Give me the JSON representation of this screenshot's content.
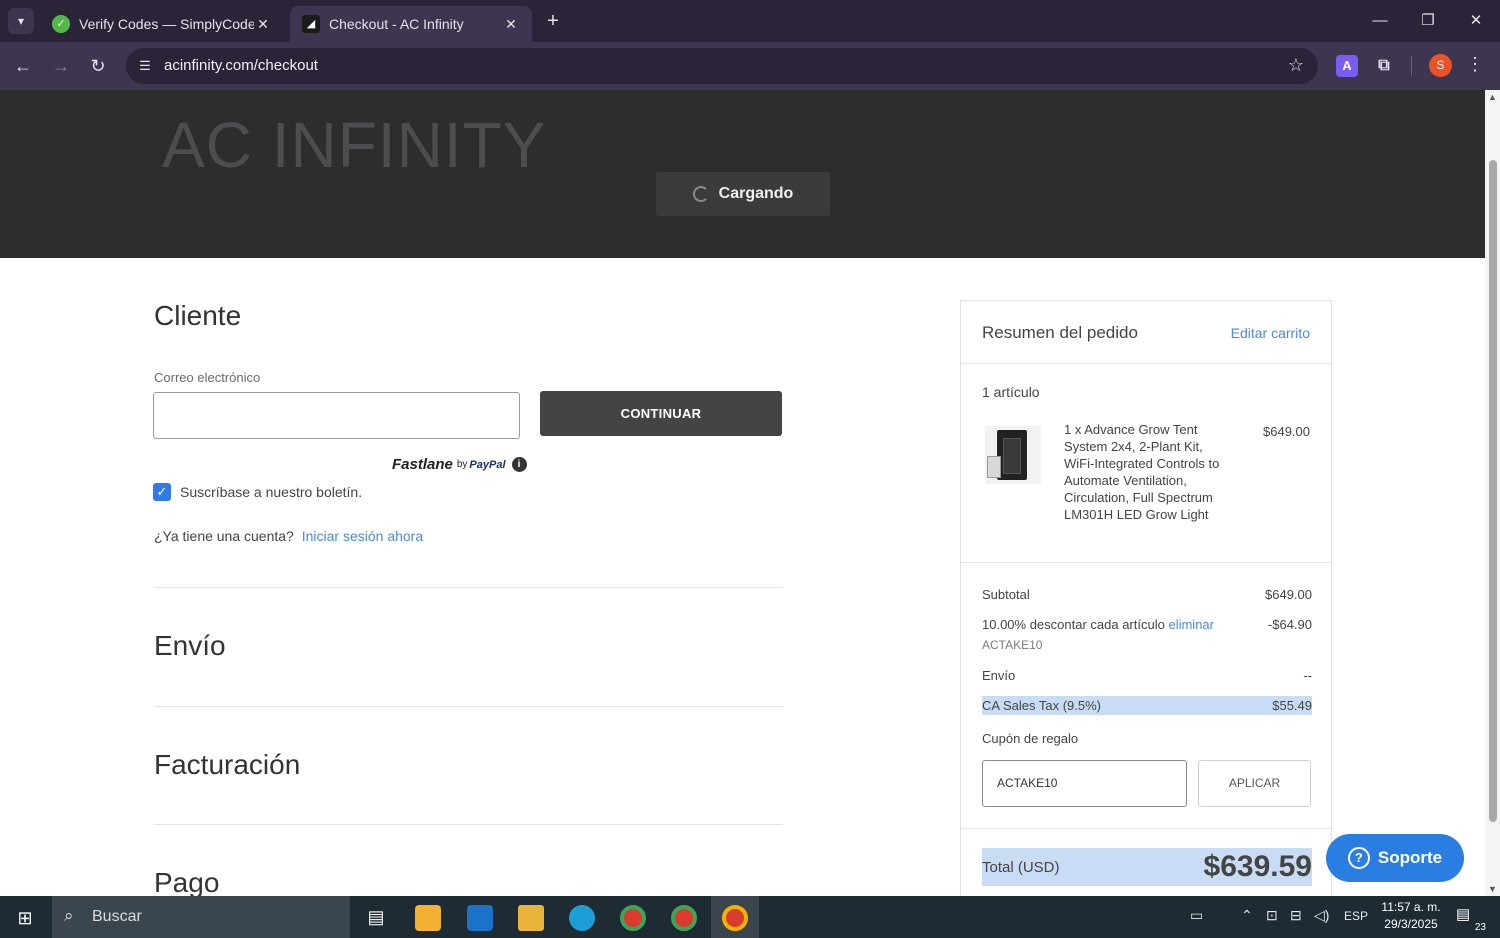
{
  "browser": {
    "tabs": [
      {
        "title": "Verify Codes — SimplyCodes",
        "favicon": "simplycodes-icon"
      },
      {
        "title": "Checkout - AC Infinity",
        "favicon": "acinfinity-icon"
      }
    ],
    "url": "acinfinity.com/checkout",
    "profile_initial": "S",
    "extension_letter": "A"
  },
  "hero": {
    "brand": "AC INFINITY",
    "loading_label": "Cargando"
  },
  "customer": {
    "title": "Cliente",
    "email_label": "Correo electrónico",
    "email_value": "",
    "continue_label": "CONTINUAR",
    "fastlane": "Fastlane",
    "fastlane_by": "by",
    "fastlane_paypal": "PayPal",
    "newsletter_label": "Suscríbase a nuestro boletín.",
    "newsletter_checked": true,
    "account_question": "¿Ya tiene una cuenta?",
    "login_link": "Iniciar sesión ahora"
  },
  "sections": {
    "shipping": "Envío",
    "billing": "Facturación",
    "payment": "Pago"
  },
  "summary": {
    "title": "Resumen del pedido",
    "edit_cart": "Editar carrito",
    "item_count": "1 artículo",
    "item": {
      "description": "1 x Advance Grow Tent System 2x4, 2-Plant Kit, WiFi-Integrated Controls to Automate Ventilation, Circulation, Full Spectrum LM301H LED Grow Light",
      "price": "$649.00"
    },
    "subtotal_label": "Subtotal",
    "subtotal_value": "$649.00",
    "discount_label": "10.00% descontar cada artículo",
    "discount_remove": "eliminar",
    "discount_value": "-$64.90",
    "discount_code": "ACTAKE10",
    "shipping_label": "Envío",
    "shipping_value": "--",
    "tax_label": "CA Sales Tax (9.5%)",
    "tax_value": "$55.49",
    "gift_label": "Cupón de regalo",
    "gift_value": "ACTAKE10",
    "apply_label": "APLICAR",
    "total_label": "Total (USD)",
    "total_value": "$639.59"
  },
  "support": {
    "label": "Soporte"
  },
  "taskbar": {
    "search_label": "Buscar",
    "language": "ESP",
    "time": "11:57 a. m.",
    "date": "29/3/2025",
    "notifications": "23"
  },
  "colors": {
    "accent": "#2f7ae5",
    "link": "#4a8ad8",
    "highlight": "#c8dcf5",
    "hero_bg": "#2d2d2e",
    "browser_frame": "#2b2337"
  }
}
